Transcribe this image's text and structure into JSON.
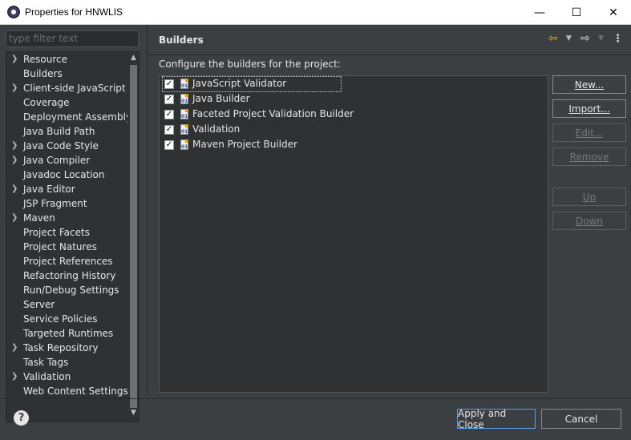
{
  "window": {
    "title": "Properties for HNWLIS",
    "minimize_glyph": "—",
    "maximize_glyph": "☐",
    "close_glyph": "✕"
  },
  "filter": {
    "placeholder": "type filter text"
  },
  "tree": {
    "items": [
      {
        "label": "Resource",
        "expandable": true
      },
      {
        "label": "Builders",
        "expandable": false
      },
      {
        "label": "Client-side JavaScript",
        "expandable": true
      },
      {
        "label": "Coverage",
        "expandable": false
      },
      {
        "label": "Deployment Assembly",
        "expandable": false
      },
      {
        "label": "Java Build Path",
        "expandable": false
      },
      {
        "label": "Java Code Style",
        "expandable": true
      },
      {
        "label": "Java Compiler",
        "expandable": true
      },
      {
        "label": "Javadoc Location",
        "expandable": false
      },
      {
        "label": "Java Editor",
        "expandable": true
      },
      {
        "label": "JSP Fragment",
        "expandable": false
      },
      {
        "label": "Maven",
        "expandable": true
      },
      {
        "label": "Project Facets",
        "expandable": false
      },
      {
        "label": "Project Natures",
        "expandable": false
      },
      {
        "label": "Project References",
        "expandable": false
      },
      {
        "label": "Refactoring History",
        "expandable": false
      },
      {
        "label": "Run/Debug Settings",
        "expandable": false
      },
      {
        "label": "Server",
        "expandable": false
      },
      {
        "label": "Service Policies",
        "expandable": false
      },
      {
        "label": "Targeted Runtimes",
        "expandable": false
      },
      {
        "label": "Task Repository",
        "expandable": true
      },
      {
        "label": "Task Tags",
        "expandable": false
      },
      {
        "label": "Validation",
        "expandable": true
      },
      {
        "label": "Web Content Settings",
        "expandable": false
      }
    ]
  },
  "page": {
    "title": "Builders",
    "description": "Configure the builders for the project:"
  },
  "builders": [
    {
      "label": "JavaScript Validator",
      "checked": true
    },
    {
      "label": "Java Builder",
      "checked": true
    },
    {
      "label": "Faceted Project Validation Builder",
      "checked": true
    },
    {
      "label": "Validation",
      "checked": true
    },
    {
      "label": "Maven Project Builder",
      "checked": true
    }
  ],
  "side_buttons": {
    "new": "New...",
    "import": "Import...",
    "edit": "Edit...",
    "remove": "Remove",
    "up": "Up",
    "down": "Down"
  },
  "footer": {
    "apply_close": "Apply and Close",
    "cancel": "Cancel",
    "help_glyph": "?"
  },
  "colors": {
    "background": "#3c3f41",
    "list_background": "#2f3133",
    "nav_back_arrow": "#f0b400",
    "primary_button_border": "#5aa0e6"
  }
}
